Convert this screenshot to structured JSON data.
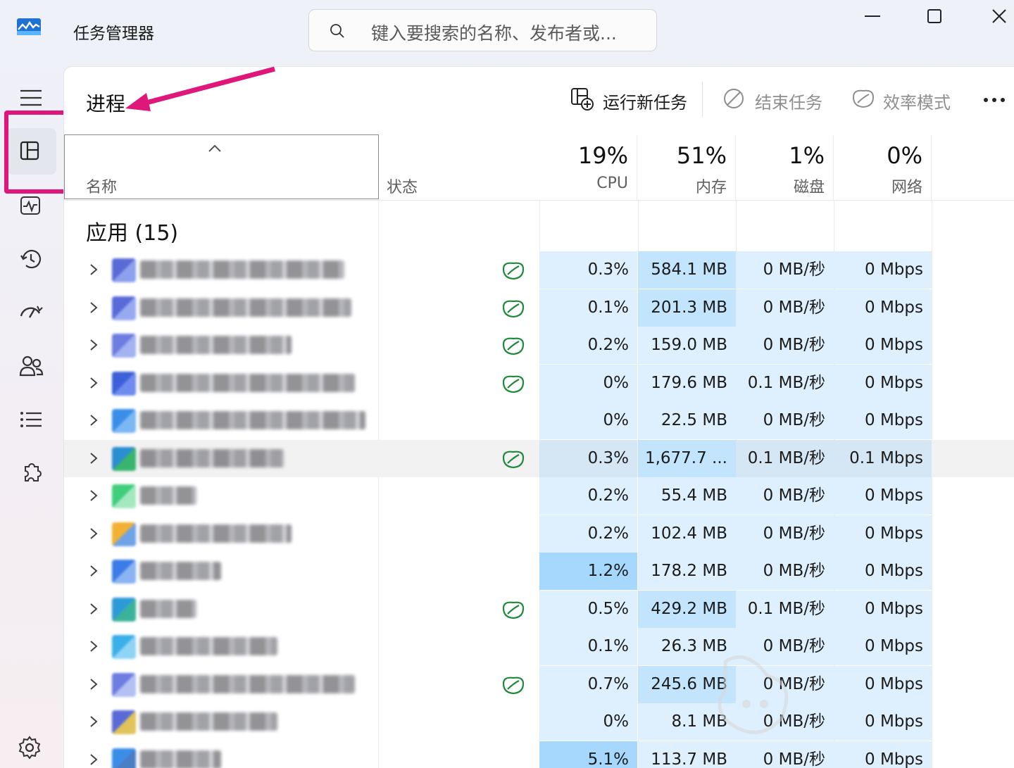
{
  "app": {
    "title": "任务管理器",
    "icon": "task-manager-logo"
  },
  "search": {
    "placeholder": "键入要搜索的名称、发布者或..."
  },
  "window_controls": [
    "minimize-icon",
    "maximize-icon",
    "close-icon"
  ],
  "nav": {
    "items": [
      {
        "id": "menu",
        "icon": "hamburger-icon"
      },
      {
        "id": "processes",
        "icon": "processes-icon",
        "active": true
      },
      {
        "id": "performance",
        "icon": "performance-icon"
      },
      {
        "id": "app-history",
        "icon": "history-icon"
      },
      {
        "id": "startup-apps",
        "icon": "startup-icon"
      },
      {
        "id": "users",
        "icon": "users-icon"
      },
      {
        "id": "details",
        "icon": "details-list-icon"
      },
      {
        "id": "services",
        "icon": "services-puzzle-icon"
      },
      {
        "id": "settings",
        "icon": "settings-gear-icon"
      }
    ]
  },
  "page": {
    "title": "进程"
  },
  "toolbar": {
    "run_new_task": "运行新任务",
    "end_task": "结束任务",
    "efficiency_mode": "效率模式",
    "more": "more-options-icon"
  },
  "columns": {
    "name": "名称",
    "status": "状态",
    "cpu": {
      "pct": "19%",
      "label": "CPU"
    },
    "memory": {
      "pct": "51%",
      "label": "内存"
    },
    "disk": {
      "pct": "1%",
      "label": "磁盘"
    },
    "network": {
      "pct": "0%",
      "label": "网络"
    }
  },
  "group": {
    "title": "应用 (15)"
  },
  "rows": [
    {
      "eco": true,
      "cpu": "0.3%",
      "memory": "584.1 MB",
      "disk": "0 MB/秒",
      "network": "0 Mbps"
    },
    {
      "eco": true,
      "cpu": "0.1%",
      "memory": "201.3 MB",
      "disk": "0 MB/秒",
      "network": "0 Mbps"
    },
    {
      "eco": true,
      "cpu": "0.2%",
      "memory": "159.0 MB",
      "disk": "0 MB/秒",
      "network": "0 Mbps"
    },
    {
      "eco": true,
      "cpu": "0%",
      "memory": "179.6 MB",
      "disk": "0.1 MB/秒",
      "network": "0 Mbps"
    },
    {
      "eco": false,
      "cpu": "0%",
      "memory": "22.5 MB",
      "disk": "0 MB/秒",
      "network": "0 Mbps"
    },
    {
      "eco": true,
      "cpu": "0.3%",
      "memory": "1,677.7 ...",
      "disk": "0.1 MB/秒",
      "network": "0.1 Mbps"
    },
    {
      "eco": false,
      "cpu": "0.2%",
      "memory": "55.4 MB",
      "disk": "0 MB/秒",
      "network": "0 Mbps"
    },
    {
      "eco": false,
      "cpu": "0.2%",
      "memory": "102.4 MB",
      "disk": "0 MB/秒",
      "network": "0 Mbps"
    },
    {
      "eco": false,
      "cpu": "1.2%",
      "memory": "178.2 MB",
      "disk": "0 MB/秒",
      "network": "0 Mbps"
    },
    {
      "eco": true,
      "cpu": "0.5%",
      "memory": "429.2 MB",
      "disk": "0.1 MB/秒",
      "network": "0 Mbps"
    },
    {
      "eco": false,
      "cpu": "0.1%",
      "memory": "26.3 MB",
      "disk": "0 MB/秒",
      "network": "0 Mbps"
    },
    {
      "eco": true,
      "cpu": "0.7%",
      "memory": "245.6 MB",
      "disk": "0 MB/秒",
      "network": "0 Mbps"
    },
    {
      "eco": false,
      "cpu": "0%",
      "memory": "8.1 MB",
      "disk": "0 MB/秒",
      "network": "0 Mbps"
    },
    {
      "eco": false,
      "cpu": "5.1%",
      "memory": "113.7 MB",
      "disk": "0 MB/秒",
      "network": "0 Mbps"
    }
  ],
  "colors": {
    "annotation": "#e0177a",
    "heat_low": "#def0fe",
    "heat_mid": "#c2e4fd",
    "heat_high": "#a5d8fc",
    "eco_leaf": "#1d8a3a"
  }
}
